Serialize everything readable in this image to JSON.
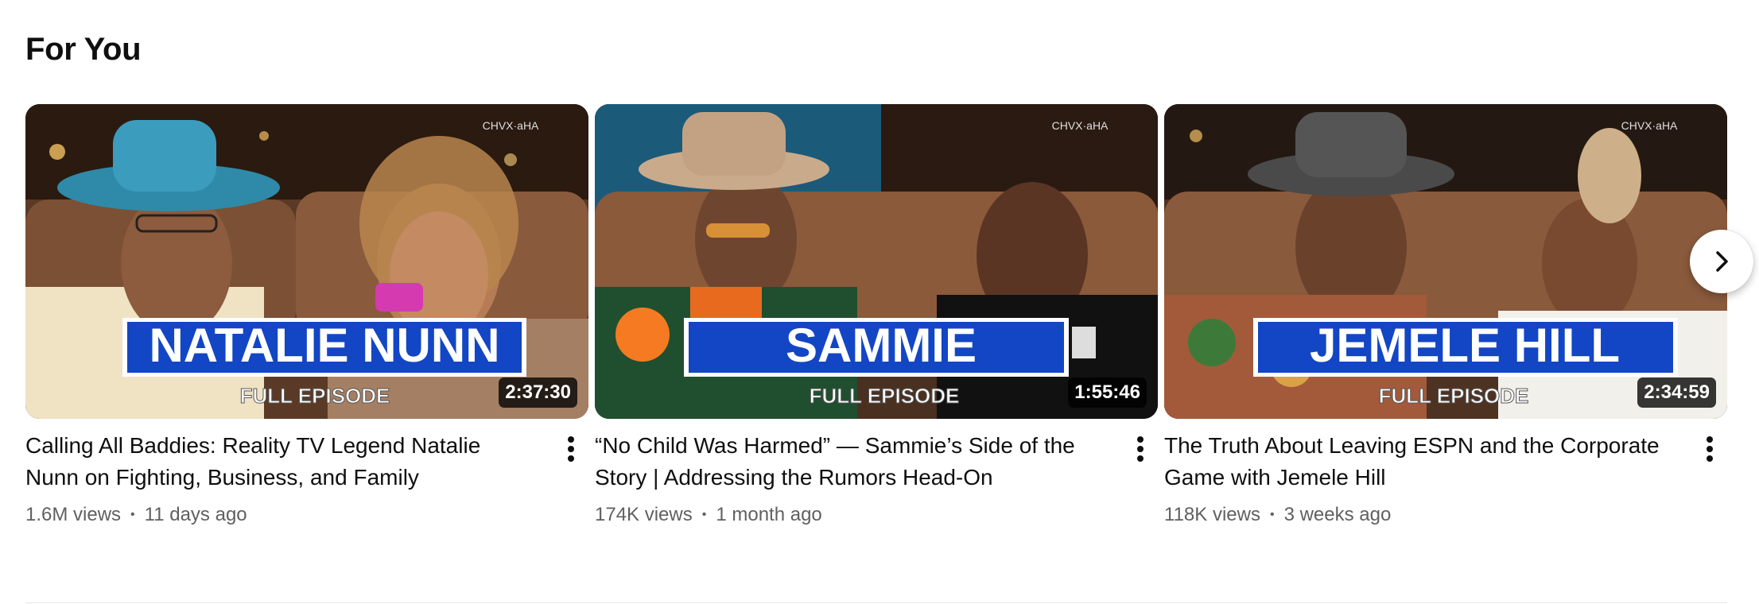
{
  "section": {
    "title": "For You",
    "next_icon": "chevron-right-icon"
  },
  "videos": [
    {
      "title": "Calling All Baddies: Reality TV Legend Natalie Nunn on Fighting, Business, and Family",
      "views": "1.6M views",
      "age": "11 days ago",
      "duration": "2:37:30",
      "banner": "NATALIE NUNN",
      "episode_tag": "FULL EPISODE",
      "banner_color": "#1346c4"
    },
    {
      "title": "“No Child Was Harmed” — Sammie’s Side of the Story | Addressing the Rumors Head-On",
      "views": "174K views",
      "age": "1 month ago",
      "duration": "1:55:46",
      "banner": "SAMMIE",
      "episode_tag": "FULL EPISODE",
      "banner_color": "#1346c4"
    },
    {
      "title": "The Truth About Leaving ESPN and the Corporate Game with Jemele Hill",
      "views": "118K views",
      "age": "3 weeks ago",
      "duration": "2:34:59",
      "banner": "JEMELE HILL",
      "episode_tag": "FULL EPISODE",
      "banner_color": "#1346c4"
    }
  ],
  "colors": {
    "text_primary": "#0f0f0f",
    "text_secondary": "#606060",
    "duration_bg": "#000000"
  }
}
